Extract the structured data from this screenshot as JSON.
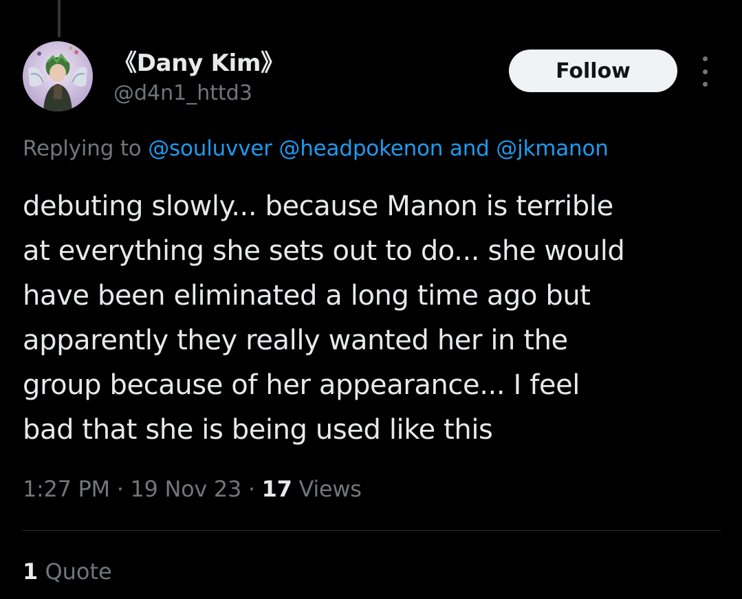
{
  "author": {
    "display_name": "《Dany Kim》",
    "handle": "@d4n1_httd3"
  },
  "actions": {
    "follow_label": "Follow",
    "more_icon": "more-vertical-icon"
  },
  "reply_context": {
    "prefix": "Replying to ",
    "mention_1": "@souluvver",
    "separator_1": " ",
    "mention_2": "@headpokenon",
    "separator_2": " and ",
    "mention_3": "@jkmanon"
  },
  "tweet": {
    "lines": [
      "debuting slowly... because Manon is terrible",
      "at everything she sets out to do... she would",
      "have been eliminated a long time ago but",
      "apparently they really wanted her in the",
      "group because of her appearance... I feel",
      "bad that she is being used like this"
    ]
  },
  "meta": {
    "time": "1:27 PM",
    "dot_1": " · ",
    "date": "19 Nov 23",
    "dot_2": " · ",
    "views_count": "17",
    "views_label": " Views"
  },
  "engagement": {
    "quote_count": "1",
    "quote_label": " Quote"
  },
  "colors": {
    "background": "#000000",
    "text_primary": "#e7e9ea",
    "text_secondary": "#71767b",
    "accent": "#1d9bf0",
    "follow_bg": "#eff3f4",
    "divider": "#2f3336"
  }
}
